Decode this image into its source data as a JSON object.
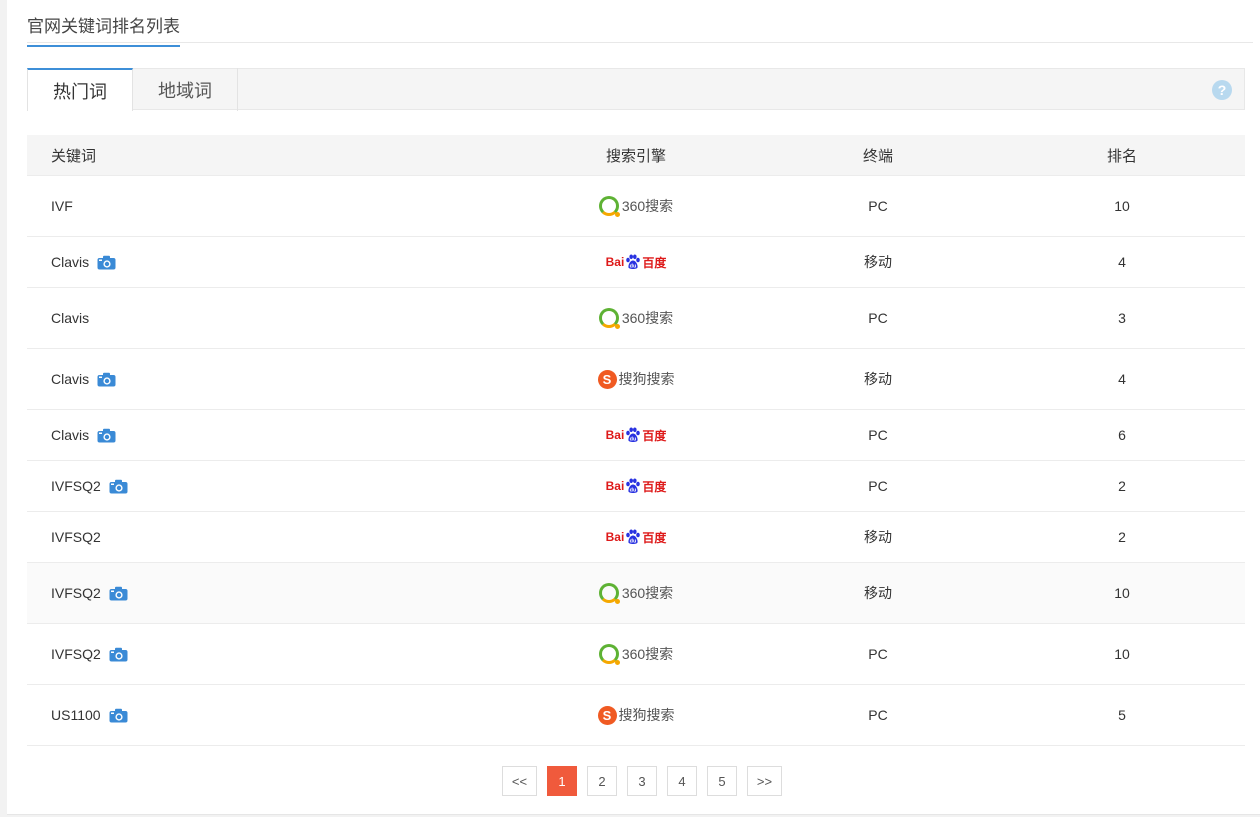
{
  "page": {
    "title": "官网关键词排名列表"
  },
  "tabs": [
    {
      "label": "热门词"
    },
    {
      "label": "地域词"
    }
  ],
  "help": {
    "symbol": "?"
  },
  "table": {
    "headers": {
      "keyword": "关键词",
      "engine": "搜索引擎",
      "terminal": "终端",
      "rank": "排名"
    },
    "rows": [
      {
        "keyword": "IVF",
        "snapshot": false,
        "engine": "360",
        "terminal": "PC",
        "rank": "10"
      },
      {
        "keyword": "Clavis",
        "snapshot": true,
        "engine": "baidu",
        "terminal": "移动",
        "rank": "4"
      },
      {
        "keyword": "Clavis",
        "snapshot": false,
        "engine": "360",
        "terminal": "PC",
        "rank": "3"
      },
      {
        "keyword": "Clavis",
        "snapshot": true,
        "engine": "sogou",
        "terminal": "移动",
        "rank": "4"
      },
      {
        "keyword": "Clavis",
        "snapshot": true,
        "engine": "baidu",
        "terminal": "PC",
        "rank": "6"
      },
      {
        "keyword": "IVFSQ2",
        "snapshot": true,
        "engine": "baidu",
        "terminal": "PC",
        "rank": "2"
      },
      {
        "keyword": "IVFSQ2",
        "snapshot": false,
        "engine": "baidu",
        "terminal": "移动",
        "rank": "2"
      },
      {
        "keyword": "IVFSQ2",
        "snapshot": true,
        "engine": "360",
        "terminal": "移动",
        "rank": "10"
      },
      {
        "keyword": "IVFSQ2",
        "snapshot": true,
        "engine": "360",
        "terminal": "PC",
        "rank": "10"
      },
      {
        "keyword": "US1100",
        "snapshot": true,
        "engine": "sogou",
        "terminal": "PC",
        "rank": "5"
      }
    ]
  },
  "engines": {
    "360": {
      "label": "360搜索"
    },
    "sogou": {
      "mark": "S",
      "label": "搜狗搜索"
    },
    "baidu": {
      "prefix": "Bai",
      "paw_text": "du",
      "suffix": "百度"
    }
  },
  "pagination": {
    "prev": "<<",
    "next": ">>",
    "pages": [
      "1",
      "2",
      "3",
      "4",
      "5"
    ],
    "current": "1"
  },
  "colors": {
    "accent_blue": "#3d8fd8",
    "active_page": "#f05a3c",
    "icon_blue": "#3a8ad6"
  }
}
